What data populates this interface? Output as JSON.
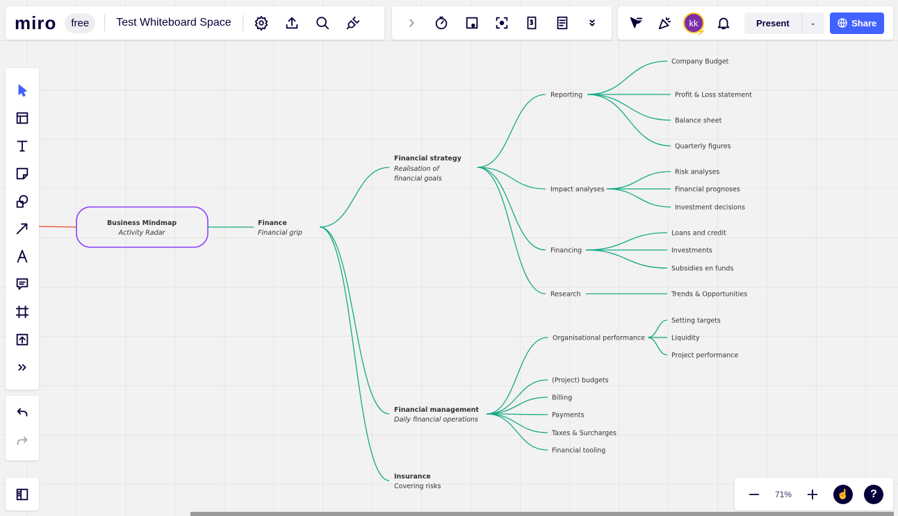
{
  "topbar": {
    "logo": "miro",
    "plan": "free",
    "board_title": "Test Whiteboard Space",
    "icons": [
      "gear-icon",
      "upload-icon",
      "search-icon",
      "plug-icon"
    ]
  },
  "tools_bar": {
    "icons": [
      "chevron-right-icon",
      "timer-icon",
      "video-icon",
      "focus-icon",
      "card-icon",
      "notes-icon",
      "chevron-double-down-icon"
    ]
  },
  "collab_bar": {
    "avatar_initials": "kk",
    "present_label": "Present",
    "share_label": "Share",
    "accent": "#4262ff",
    "avatar_color": "#7b2ea8"
  },
  "left_toolbar": {
    "tools": [
      "select",
      "templates",
      "text",
      "sticky-note",
      "shapes",
      "arrow",
      "pen",
      "comment",
      "frame",
      "upload",
      "more"
    ]
  },
  "zoom": {
    "level": "71%"
  },
  "mindmap": {
    "root": {
      "title": "Business Mindmap",
      "subtitle": "Activity Radar",
      "color": "#8a3ffc"
    },
    "branch_color": "#12a883",
    "finance": {
      "title": "Finance",
      "subtitle": "Financial grip"
    },
    "strategy": {
      "title": "Financial strategy",
      "subtitle1": "Realisation of",
      "subtitle2": "financial goals"
    },
    "management": {
      "title": "Financial management",
      "subtitle": "Daily financial operations"
    },
    "insurance": {
      "title": "Insurance",
      "subtitle": "Covering risks"
    },
    "reporting": {
      "label": "Reporting",
      "children": [
        "Company Budget",
        "Profit & Loss statement",
        "Balance sheet",
        "Quarterly figures"
      ]
    },
    "impact": {
      "label": "Impact analyses",
      "children": [
        "Risk analyses",
        "Financial prognoses",
        "Investment decisions"
      ]
    },
    "financing": {
      "label": "Financing",
      "children": [
        "Loans and credit",
        "Investments",
        "Subsidies en funds"
      ]
    },
    "research": {
      "label": "Research",
      "children": [
        "Trends & Opportunities"
      ]
    },
    "management_children": [
      "(Project) budgets",
      "Billing",
      "Payments",
      "Taxes & Surcharges",
      "Financial tooling"
    ],
    "org": {
      "label": "Organisational performance",
      "children": [
        "Setting targets",
        "Liquidity",
        "Project performance"
      ]
    }
  }
}
